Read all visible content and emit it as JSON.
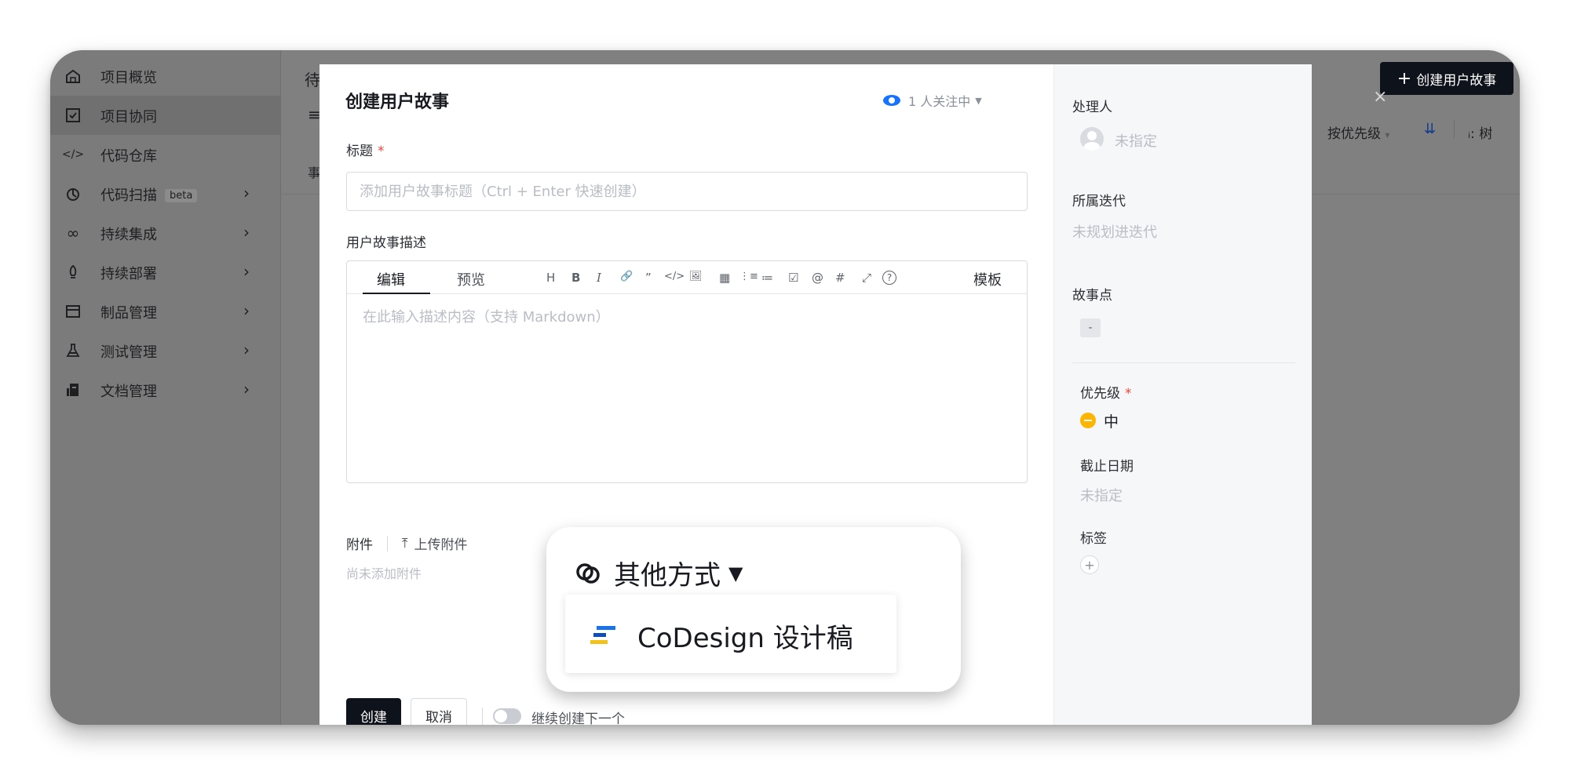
{
  "sidebar": {
    "items": [
      {
        "icon": "home-icon",
        "label": "项目概览"
      },
      {
        "icon": "checkbox-icon",
        "label": "项目协同"
      },
      {
        "icon": "code-icon",
        "label": "代码仓库"
      },
      {
        "icon": "scan-icon",
        "label": "代码扫描",
        "badge": "beta"
      },
      {
        "icon": "infinity-icon",
        "label": "持续集成"
      },
      {
        "icon": "deploy-icon",
        "label": "持续部署"
      },
      {
        "icon": "artifact-icon",
        "label": "制品管理"
      },
      {
        "icon": "flask-icon",
        "label": "测试管理"
      },
      {
        "icon": "doc-icon",
        "label": "文档管理"
      }
    ]
  },
  "background": {
    "header_text": "待",
    "row_text": "事",
    "create_button": "创建用户故事",
    "sort_label": "按优先级",
    "tree_label": "树",
    "colon": ":"
  },
  "modal": {
    "title": "创建用户故事",
    "followers": "1 人关注中",
    "title_label": "标题",
    "required_mark": "*",
    "title_placeholder": "添加用户故事标题（Ctrl + Enter 快速创建）",
    "desc_label": "用户故事描述",
    "editor": {
      "tab_edit": "编辑",
      "tab_preview": "预览",
      "tools": [
        "H",
        "B",
        "I",
        "🔗",
        "”",
        "</>",
        "🖼",
        "▦",
        "⋮≡",
        "≔",
        "☑",
        "@",
        "#",
        "⤢",
        "?"
      ],
      "template": "模板",
      "placeholder": "在此输入描述内容（支持 Markdown）"
    },
    "attachment_label": "附件",
    "upload_label": "上传附件",
    "no_attachment": "尚未添加附件",
    "create_button": "创建",
    "cancel_button": "取消",
    "continue_label": "继续创建下一个"
  },
  "right_panel": {
    "assignee_label": "处理人",
    "assignee_value": "未指定",
    "iteration_label": "所属迭代",
    "iteration_value": "未规划进迭代",
    "points_label": "故事点",
    "points_value": "-",
    "priority_label": "优先级",
    "priority_value": "中",
    "due_label": "截止日期",
    "due_value": "未指定",
    "tags_label": "标签",
    "tags_add": "+"
  },
  "popover": {
    "title": "其他方式",
    "item": "CoDesign 设计稿"
  },
  "colors": {
    "primary_dark": "#0e121a",
    "accent_blue": "#1673ff",
    "priority_medium": "#ffb400",
    "required_red": "#f5433b"
  }
}
